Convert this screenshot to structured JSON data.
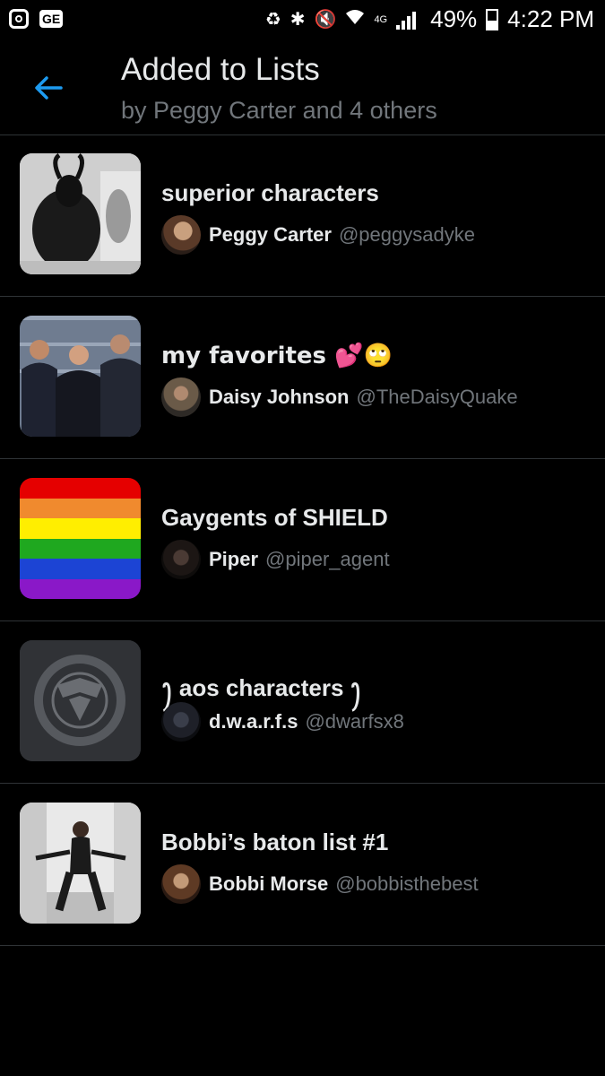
{
  "status_bar": {
    "left_icons": [
      "instagram-icon",
      "ge-icon"
    ],
    "right_icons": [
      "recycle-icon",
      "bluetooth-icon",
      "mute-icon",
      "wifi-icon",
      "4g-icon",
      "signal-icon"
    ],
    "network": "4G",
    "battery": "49%",
    "time": "4:22 PM"
  },
  "header": {
    "title": "Added to Lists",
    "subtitle": "by Peggy Carter and 4 others",
    "accent_color": "#1d9bf0"
  },
  "lists": [
    {
      "name": "superior characters",
      "owner_name": "Peggy Carter",
      "owner_handle": "@peggysadyke",
      "thumb": "goat-photo-thumbnail"
    },
    {
      "name": "my favorites 💕🙄",
      "owner_name": "Daisy Johnson",
      "owner_handle": "@TheDaisyQuake",
      "thumb": "group-photo-thumbnail"
    },
    {
      "name": "Gaygents of SHIELD",
      "owner_name": "Piper",
      "owner_handle": "@piper_agent",
      "thumb": "rainbow-flag-thumbnail"
    },
    {
      "name": "ꫂ aos characters ꫂ",
      "owner_name": "d.w.a.r.f.s",
      "owner_handle": "@dwarfsx8",
      "thumb": "shield-logo-thumbnail"
    },
    {
      "name": "Bobbi’s baton list #1",
      "owner_name": "Bobbi Morse",
      "owner_handle": "@bobbisthebest",
      "thumb": "baton-photo-thumbnail"
    }
  ],
  "rainbow_colors": [
    "#e50000",
    "#f08a2e",
    "#ffee00",
    "#1fa81f",
    "#1c44d4",
    "#8a18c8"
  ]
}
